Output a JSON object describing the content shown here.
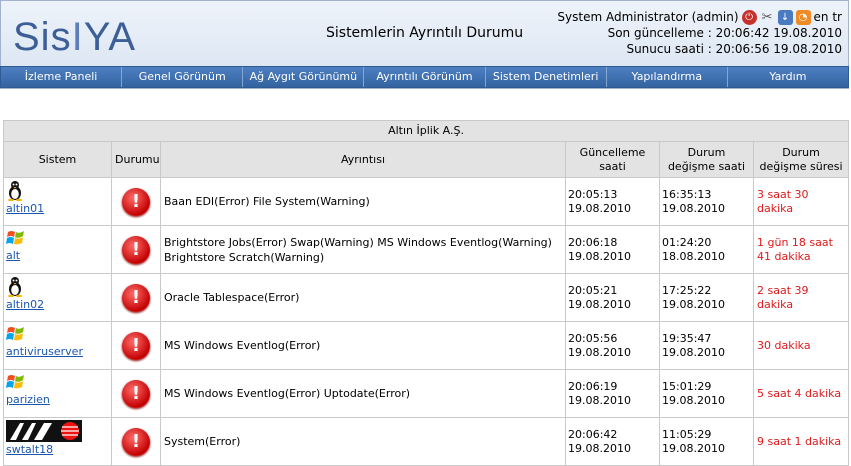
{
  "header": {
    "logo": {
      "part1": "Sis",
      "part2": "YA"
    },
    "title": "Sistemlerin Ayrıntılı Durumu",
    "user": "System Administrator (admin)",
    "lang": "en tr",
    "last_update": "Son güncelleme : 20:06:42 19.08.2010",
    "server_time": "Sunucu saati : 20:06:56 19.08.2010",
    "icons": [
      "power-icon",
      "tools-icon",
      "download-icon",
      "rss-icon"
    ]
  },
  "nav": [
    "İzleme Paneli",
    "Genel Görünüm",
    "Ağ Aygıt Görünümü",
    "Ayrıntılı Görünüm",
    "Sistem Denetimleri",
    "Yapılandırma",
    "Yardım"
  ],
  "table": {
    "company": "Altın İplik A.Ş.",
    "columns": [
      "Sistem",
      "Durumu",
      "Ayrıntısı",
      "Güncelleme saati",
      "Durum değişme saati",
      "Durum değişme süresi"
    ],
    "rows": [
      {
        "os": "linux",
        "name": "altin01",
        "detail": "Baan EDI(Error) File System(Warning)",
        "upd_time": "20:05:13",
        "upd_date": "19.08.2010",
        "chg_time": "16:35:13",
        "chg_date": "19.08.2010",
        "duration": "3 saat 30 dakika"
      },
      {
        "os": "windows",
        "name": "alt",
        "detail": "Brightstore Jobs(Error) Swap(Warning) MS Windows Eventlog(Warning) Brightstore Scratch(Warning)",
        "upd_time": "20:06:18",
        "upd_date": "19.08.2010",
        "chg_time": "01:24:20",
        "chg_date": "18.08.2010",
        "duration": "1 gün 18 saat 41 dakika"
      },
      {
        "os": "linux",
        "name": "altin02",
        "detail": "Oracle Tablespace(Error)",
        "upd_time": "20:05:21",
        "upd_date": "19.08.2010",
        "chg_time": "17:25:22",
        "chg_date": "19.08.2010",
        "duration": "2 saat 39 dakika"
      },
      {
        "os": "windows",
        "name": "antiviruserver",
        "detail": "MS Windows Eventlog(Error)",
        "upd_time": "20:05:56",
        "upd_date": "19.08.2010",
        "chg_time": "19:35:47",
        "chg_date": "19.08.2010",
        "duration": "30 dakika"
      },
      {
        "os": "windows",
        "name": "parizien",
        "detail": "MS Windows Eventlog(Error) Uptodate(Error)",
        "upd_time": "20:06:19",
        "upd_date": "19.08.2010",
        "chg_time": "15:01:29",
        "chg_date": "19.08.2010",
        "duration": "5 saat 4 dakika"
      },
      {
        "os": "switch",
        "name": "swtalt18",
        "detail": "System(Error)",
        "upd_time": "20:06:42",
        "upd_date": "19.08.2010",
        "chg_time": "11:05:29",
        "chg_date": "19.08.2010",
        "duration": "9 saat 1 dakika"
      }
    ]
  },
  "colors": {
    "accent": "#3d6cad",
    "error": "#e0191b",
    "link": "#1a56b0"
  }
}
